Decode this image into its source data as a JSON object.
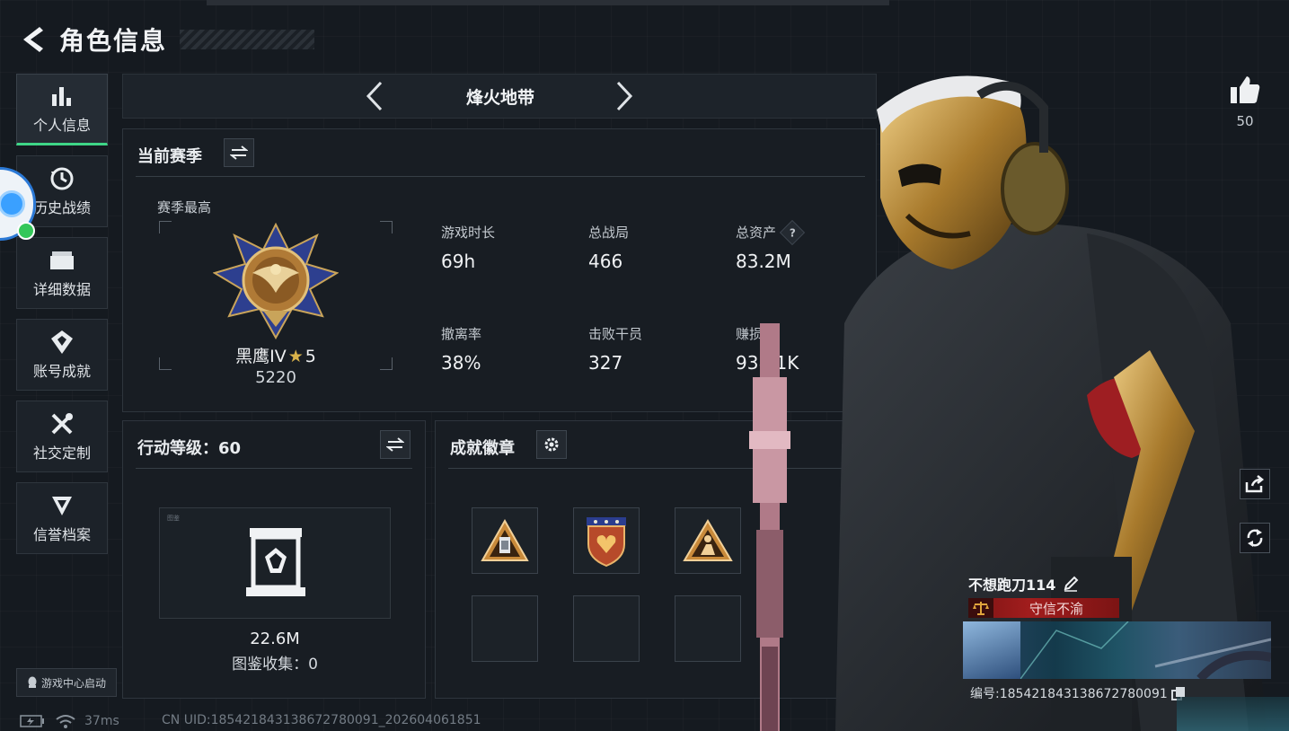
{
  "header": {
    "title": "角色信息"
  },
  "sidebar": {
    "items": [
      {
        "label": "个人信息",
        "icon": "bar-chart-icon",
        "active": true
      },
      {
        "label": "历史战绩",
        "icon": "history-clock-icon"
      },
      {
        "label": "详细数据",
        "icon": "folder-icon"
      },
      {
        "label": "账号成就",
        "icon": "achievement-icon"
      },
      {
        "label": "社交定制",
        "icon": "tools-icon"
      },
      {
        "label": "信誉档案",
        "icon": "shield-icon"
      }
    ],
    "game_center": "游戏中心启动"
  },
  "mode": {
    "name": "烽火地带"
  },
  "season": {
    "title": "当前赛季",
    "subtitle": "赛季最高",
    "rank_name": "黑鹰IV",
    "rank_stars": "5",
    "rank_score": "5220",
    "stats": [
      {
        "label": "游戏时长",
        "value": "69h"
      },
      {
        "label": "总战局",
        "value": "466"
      },
      {
        "label": "总资产",
        "value": "83.2M",
        "help": "?"
      },
      {
        "label": "撤离率",
        "value": "38%"
      },
      {
        "label": "击败干员",
        "value": "327"
      },
      {
        "label": "赚损比",
        "value": "938.1K"
      }
    ]
  },
  "level": {
    "title": "行动等级：60",
    "box_caption": "图鉴",
    "value": "22.6M",
    "collection": "图鉴收集：0"
  },
  "badges": {
    "title": "成就徽章"
  },
  "like": {
    "count": "50"
  },
  "profile": {
    "name": "不想跑刀114",
    "title_tag": "守信不渝",
    "id": "编号:1854218431386727800​91"
  },
  "status": {
    "ping": "37ms",
    "uid": "CN UID:1854218431386727800​91_202604061851"
  },
  "colors": {
    "accent": "#3ed587",
    "tag_red": "#a11d1d",
    "panel": "#181d23"
  }
}
